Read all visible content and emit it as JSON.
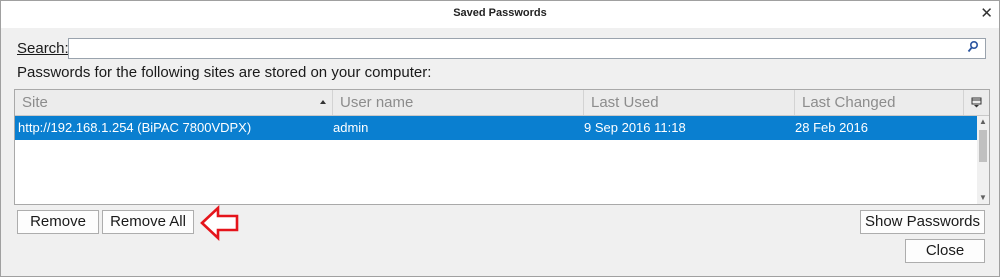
{
  "window": {
    "title": "Saved Passwords",
    "close_glyph": "✕"
  },
  "search": {
    "label": "Search:",
    "mnemonic": "S",
    "value": "",
    "placeholder": "",
    "icon": "magnifier-icon"
  },
  "description": "Passwords for the following sites are stored on your computer:",
  "table": {
    "columns": [
      {
        "label": "Site",
        "sorted": "ascending"
      },
      {
        "label": "User name"
      },
      {
        "label": "Last Used"
      },
      {
        "label": "Last Changed"
      }
    ],
    "column_picker_icon": "column-picker-icon",
    "rows": [
      {
        "site": "http://192.168.1.254 (BiPAC 7800VDPX)",
        "username": "admin",
        "last_used": "9 Sep 2016 11:18",
        "last_changed": "28 Feb 2016",
        "selected": true
      }
    ]
  },
  "buttons": {
    "remove": "Remove",
    "remove_all": "Remove All",
    "show_passwords": "Show Passwords",
    "close": "Close"
  },
  "colors": {
    "selection": "#0a7fd0",
    "annotation_arrow": "#e5141b"
  }
}
